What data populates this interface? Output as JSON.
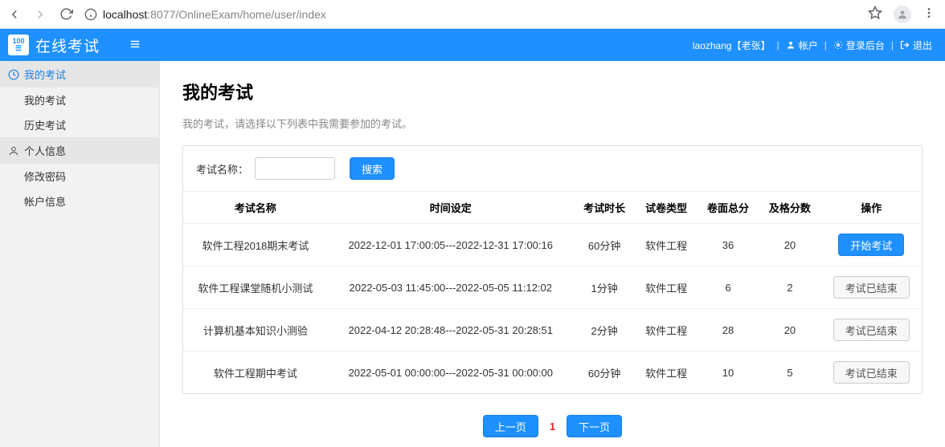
{
  "browser": {
    "url_host": "localhost",
    "url_port": ":8077",
    "url_path": "/OnlineExam/home/user/index"
  },
  "header": {
    "app_title": "在线考试",
    "user_info": "laozhang【老张】",
    "link_account": "帐户",
    "link_backend": "登录后台",
    "link_logout": "退出"
  },
  "sidebar": {
    "group1_title": "我的考试",
    "group1_items": [
      {
        "label": "我的考试"
      },
      {
        "label": "历史考试"
      }
    ],
    "group2_title": "个人信息",
    "group2_items": [
      {
        "label": "修改密码"
      },
      {
        "label": "帐户信息"
      }
    ]
  },
  "main": {
    "title": "我的考试",
    "subtitle": "我的考试，请选择以下列表中我需要参加的考试。",
    "search_label": "考试名称：",
    "search_value": "",
    "search_btn": "搜索",
    "columns": [
      "考试名称",
      "时间设定",
      "考试时长",
      "试卷类型",
      "卷面总分",
      "及格分数",
      "操作"
    ],
    "rows": [
      {
        "name": "软件工程2018期末考试",
        "time": "2022-12-01 17:00:05---2022-12-31 17:00:16",
        "duration": "60分钟",
        "type": "软件工程",
        "total": "36",
        "pass": "20",
        "action_label": "开始考试",
        "action_primary": true
      },
      {
        "name": "软件工程课堂随机小测试",
        "time": "2022-05-03 11:45:00---2022-05-05 11:12:02",
        "duration": "1分钟",
        "type": "软件工程",
        "total": "6",
        "pass": "2",
        "action_label": "考试已结束",
        "action_primary": false
      },
      {
        "name": "计算机基本知识小测验",
        "time": "2022-04-12 20:28:48---2022-05-31 20:28:51",
        "duration": "2分钟",
        "type": "软件工程",
        "total": "28",
        "pass": "20",
        "action_label": "考试已结束",
        "action_primary": false
      },
      {
        "name": "软件工程期中考试",
        "time": "2022-05-01 00:00:00---2022-05-31 00:00:00",
        "duration": "60分钟",
        "type": "软件工程",
        "total": "10",
        "pass": "5",
        "action_label": "考试已结束",
        "action_primary": false
      }
    ],
    "paginator": {
      "prev": "上一页",
      "page": "1",
      "next": "下一页"
    }
  }
}
